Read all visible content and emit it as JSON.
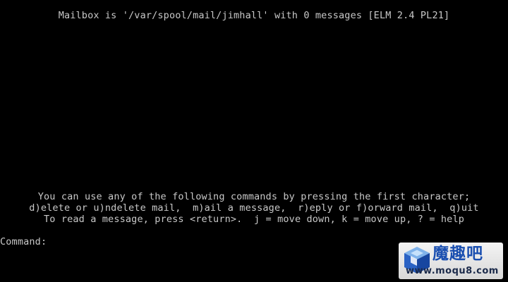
{
  "screen": {
    "header": "Mailbox is '/var/spool/mail/jimhall' with 0 messages [ELM 2.4 PL21]",
    "help_lines": [
      "You can use any of the following commands by pressing the first character;",
      "d)elete or u)ndelete mail,  m)ail a message,  r)eply or f)orward mail,  q)uit",
      "To read a message, press <return>.  j = move down, k = move up, ? = help"
    ],
    "command_prompt": "Command:",
    "command_value": ""
  },
  "watermark": {
    "logo_text": "魔趣吧",
    "url": "www.moqu8.com"
  },
  "colors": {
    "background": "#000000",
    "text": "#c8c8c8",
    "watermark_blue": "#1a4fb0"
  }
}
